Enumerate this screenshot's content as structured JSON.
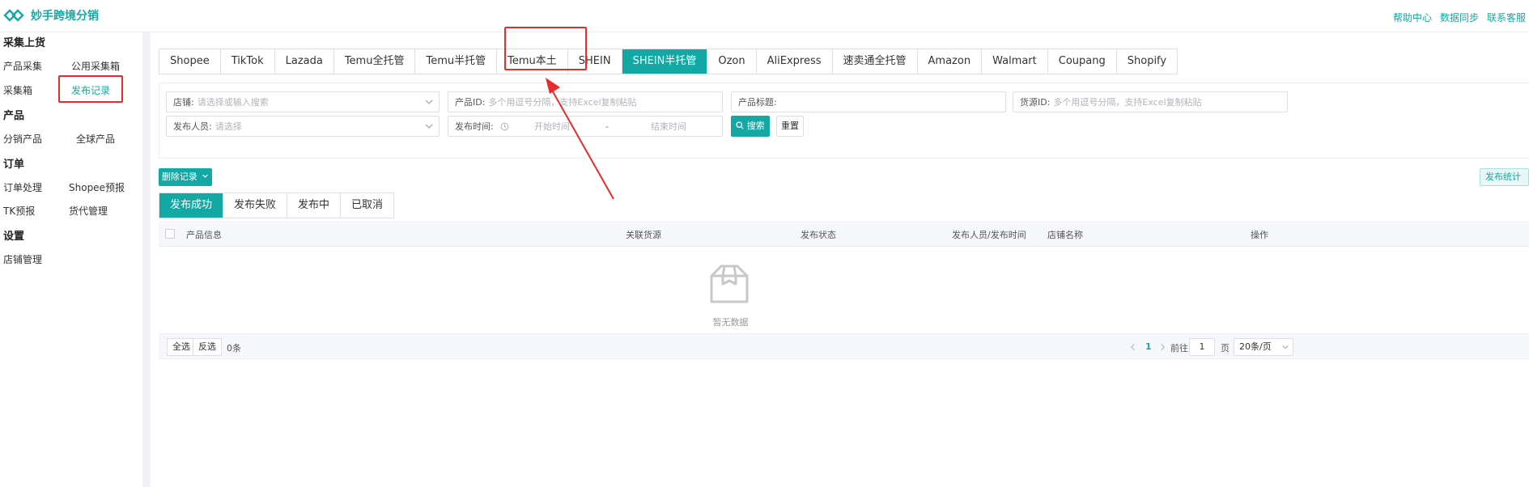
{
  "header": {
    "app_title": "妙手跨境分销",
    "links": [
      "帮助中心",
      "数据同步",
      "联系客服"
    ],
    "accent_color": "#13a8a4"
  },
  "sidebar": {
    "sections": [
      {
        "title": "采集上货",
        "items": [
          "产品采集",
          "公用采集箱",
          "采集箱",
          "发布记录"
        ]
      },
      {
        "title": "产品",
        "items": [
          "分销产品",
          "全球产品"
        ]
      },
      {
        "title": "订单",
        "items": [
          "订单处理",
          "Shopee预报",
          "TK预报",
          "货代管理"
        ]
      },
      {
        "title": "设置",
        "items": [
          "店铺管理"
        ]
      }
    ],
    "active_item": "发布记录"
  },
  "platform_tabs": [
    "Shopee",
    "TikTok",
    "Lazada",
    "Temu全托管",
    "Temu半托管",
    "Temu本土",
    "SHEIN",
    "SHEIN半托管",
    "Ozon",
    "AliExpress",
    "速卖通全托管",
    "Amazon",
    "Walmart",
    "Coupang",
    "Shopify"
  ],
  "active_platform": "SHEIN半托管",
  "filters": {
    "store_label": "店铺:",
    "store_placeholder": "请选择或输入搜索",
    "product_id_label": "产品ID:",
    "product_id_placeholder": "多个用逗号分隔，支持Excel复制粘贴",
    "product_title_label": "产品标题:",
    "source_id_label": "货源ID:",
    "source_id_placeholder": "多个用逗号分隔，支持Excel复制粘贴",
    "publisher_label": "发布人员:",
    "publisher_placeholder": "请选择",
    "time_label": "发布时间:",
    "start_placeholder": "开始时间",
    "range_sep": "-",
    "end_placeholder": "结束时间",
    "search_label": "搜索",
    "reset_label": "重置"
  },
  "actions": {
    "delete_label": "删除记录",
    "stats_label": "发布统计"
  },
  "status_tabs": [
    "发布成功",
    "发布失败",
    "发布中",
    "已取消"
  ],
  "active_status": "发布成功",
  "table": {
    "columns": [
      "产品信息",
      "关联货源",
      "发布状态",
      "发布人员/发布时间",
      "店铺名称",
      "操作"
    ],
    "empty_text": "暂无数据"
  },
  "footer": {
    "select_all": "全选",
    "invert": "反选",
    "count": "0条",
    "current_page": "1",
    "goto_label": "前往",
    "goto_value": "1",
    "page_unit": "页",
    "page_size": "20条/页"
  }
}
